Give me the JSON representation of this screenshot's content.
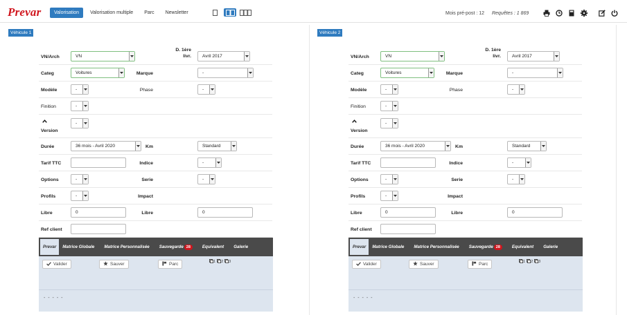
{
  "header": {
    "logo": "Prevar",
    "nav": [
      {
        "label": "Valorisation",
        "active": true
      },
      {
        "label": "Valorisation multiple",
        "active": false
      },
      {
        "label": "Parc",
        "active": false
      },
      {
        "label": "Newsletter",
        "active": false
      }
    ],
    "view_toggles": [
      "single-column-icon",
      "two-columns-icon",
      "three-columns-icon"
    ],
    "active_view": "two-columns-icon",
    "stats": {
      "mois_label": "Mois pré-post : 12",
      "requetes_label": "Requêtes : 1 869"
    },
    "tools": [
      "print-icon",
      "clock-icon",
      "calculator-icon",
      "gear-icon",
      "edit-icon",
      "power-icon"
    ]
  },
  "vehicles": [
    {
      "tag": "Véhicule 1",
      "vn_arch": {
        "label": "VN/Arch",
        "value": "VN"
      },
      "date_livr": {
        "label_line1": "D. 1ère",
        "label_line2": "livr.",
        "value": "Avril 2017"
      },
      "categ": {
        "label": "Categ",
        "value": "Voitures"
      },
      "marque": {
        "label": "Marque",
        "value": "-"
      },
      "modele": {
        "label": "Modèle",
        "value": "-"
      },
      "phase": {
        "label": "Phase",
        "value": "-"
      },
      "finition": {
        "label": "Finition",
        "value": "-"
      },
      "version": {
        "label": "Version",
        "value": "-"
      },
      "duree": {
        "label": "Durée",
        "value": "36 mois - Avril 2020"
      },
      "km": {
        "label": "Km",
        "value": "Standard"
      },
      "tarif": {
        "label": "Tarif TTC",
        "value": ""
      },
      "indice": {
        "label": "Indice",
        "value": "-"
      },
      "options": {
        "label": "Options",
        "value": "-"
      },
      "serie": {
        "label": "Serie",
        "value": "-"
      },
      "profils": {
        "label": "Profils",
        "value": "-"
      },
      "impact": {
        "label": "Impact"
      },
      "libre1": {
        "label": "Libre",
        "value": "0"
      },
      "libre2": {
        "label": "Libre",
        "value": "0"
      },
      "ref_client": {
        "label": "Ref client",
        "value": ""
      },
      "tabs": [
        {
          "label": "Prevar",
          "active": true
        },
        {
          "label": "Matrice Globale"
        },
        {
          "label": "Matrice Personnalisée"
        },
        {
          "label": "Sauvegarde",
          "badge": "28"
        },
        {
          "label": "Equivalent"
        },
        {
          "label": "Galerie"
        }
      ],
      "actions": {
        "valider": "Valider",
        "sauver": "Sauver",
        "parc": "Parc"
      },
      "copies": [
        "1",
        "2",
        "3"
      ],
      "footer_text": "- - - - -"
    },
    {
      "tag": "Véhicule 2",
      "vn_arch": {
        "label": "VN/Arch",
        "value": "VN"
      },
      "date_livr": {
        "label_line1": "D. 1ère",
        "label_line2": "livr.",
        "value": "Avril 2017"
      },
      "categ": {
        "label": "Categ",
        "value": "Voitures"
      },
      "marque": {
        "label": "Marque",
        "value": "-"
      },
      "modele": {
        "label": "Modèle",
        "value": "-"
      },
      "phase": {
        "label": "Phase",
        "value": "-"
      },
      "finition": {
        "label": "Finition",
        "value": "-"
      },
      "version": {
        "label": "Version",
        "value": "-"
      },
      "duree": {
        "label": "Durée",
        "value": "36 mois - Avril 2020"
      },
      "km": {
        "label": "Km",
        "value": "Standard"
      },
      "tarif": {
        "label": "Tarif TTC",
        "value": ""
      },
      "indice": {
        "label": "Indice",
        "value": "-"
      },
      "options": {
        "label": "Options",
        "value": "-"
      },
      "serie": {
        "label": "Serie",
        "value": "-"
      },
      "profils": {
        "label": "Profils",
        "value": "-"
      },
      "impact": {
        "label": "Impact"
      },
      "libre1": {
        "label": "Libre",
        "value": "0"
      },
      "libre2": {
        "label": "Libre",
        "value": "0"
      },
      "ref_client": {
        "label": "Ref client",
        "value": ""
      },
      "tabs": [
        {
          "label": "Prevar",
          "active": true
        },
        {
          "label": "Matrice Globale"
        },
        {
          "label": "Matrice Personnalisée"
        },
        {
          "label": "Sauvegarde",
          "badge": "28"
        },
        {
          "label": "Equivalent"
        },
        {
          "label": "Galerie"
        }
      ],
      "actions": {
        "valider": "Valider",
        "sauver": "Sauver",
        "parc": "Parc"
      },
      "copies": [
        "1",
        "2",
        "3"
      ],
      "footer_text": "- - - - -"
    }
  ],
  "colors": {
    "brand": "#d0161e",
    "accent": "#2f7bbf",
    "tabbar": "#4a4a4a",
    "tabbody": "#dde5ef"
  }
}
